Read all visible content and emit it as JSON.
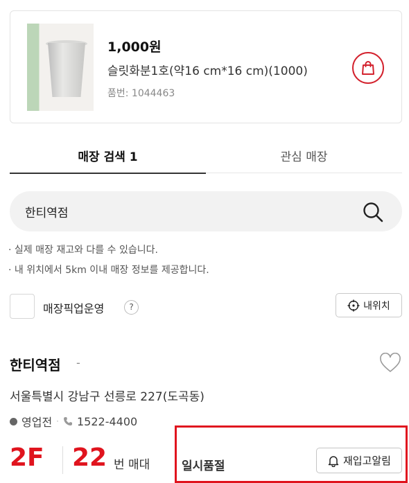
{
  "product": {
    "price": "1,000원",
    "name": "슬릿화분1호(약16 cm*16 cm)(1000)",
    "code": "품번: 1044463",
    "image_icon": "plant-pot-image",
    "cart_icon": "shopping-bag-icon",
    "accent_color": "#d3212d"
  },
  "tabs": [
    {
      "label": "매장 검색 1",
      "active": true
    },
    {
      "label": "관심 매장",
      "active": false
    }
  ],
  "search": {
    "value": "한티역점",
    "placeholder": "",
    "icon": "search-icon"
  },
  "notes": [
    "실제 매장 재고와 다를 수 있습니다.",
    "내 위치에서 5km 이내 매장 정보를 제공합니다."
  ],
  "filter": {
    "pickup_label": "매장픽업운영",
    "help_label": "?",
    "my_location_label": "내위치"
  },
  "store": {
    "name": "한티역점",
    "dash": "-",
    "address": "서울특별시 강남구 선릉로 227(도곡동)",
    "status": "영업전",
    "phone": "1522-4400",
    "floor": "2F",
    "aisle_number": "22",
    "aisle_suffix": "번 매대",
    "stock_status": "일시품절",
    "restock_button": "재입고알림",
    "status_color": "#e0141e"
  }
}
